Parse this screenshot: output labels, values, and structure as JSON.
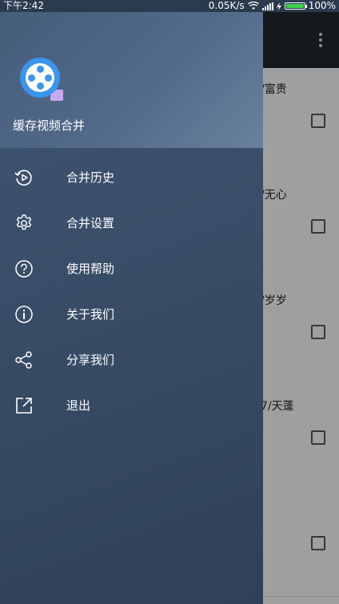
{
  "status_bar": {
    "time": "下午2:42",
    "network_speed": "0.05K/s",
    "battery": "100%",
    "battery_color": "#3cd34a"
  },
  "background_list": {
    "items": [
      {
        "label": "/富贵"
      },
      {
        "label": "/无心"
      },
      {
        "label": "/岁岁"
      },
      {
        "label": "7/天蓬"
      },
      {
        "label": ""
      }
    ]
  },
  "drawer": {
    "app_name": "缓存视频合并",
    "items": [
      {
        "label": "合并历史",
        "icon": "history-play-icon"
      },
      {
        "label": "合并设置",
        "icon": "gear-icon"
      },
      {
        "label": "使用帮助",
        "icon": "help-icon"
      },
      {
        "label": "关于我们",
        "icon": "info-icon"
      },
      {
        "label": "分享我们",
        "icon": "share-icon"
      },
      {
        "label": "退出",
        "icon": "exit-icon"
      }
    ]
  }
}
